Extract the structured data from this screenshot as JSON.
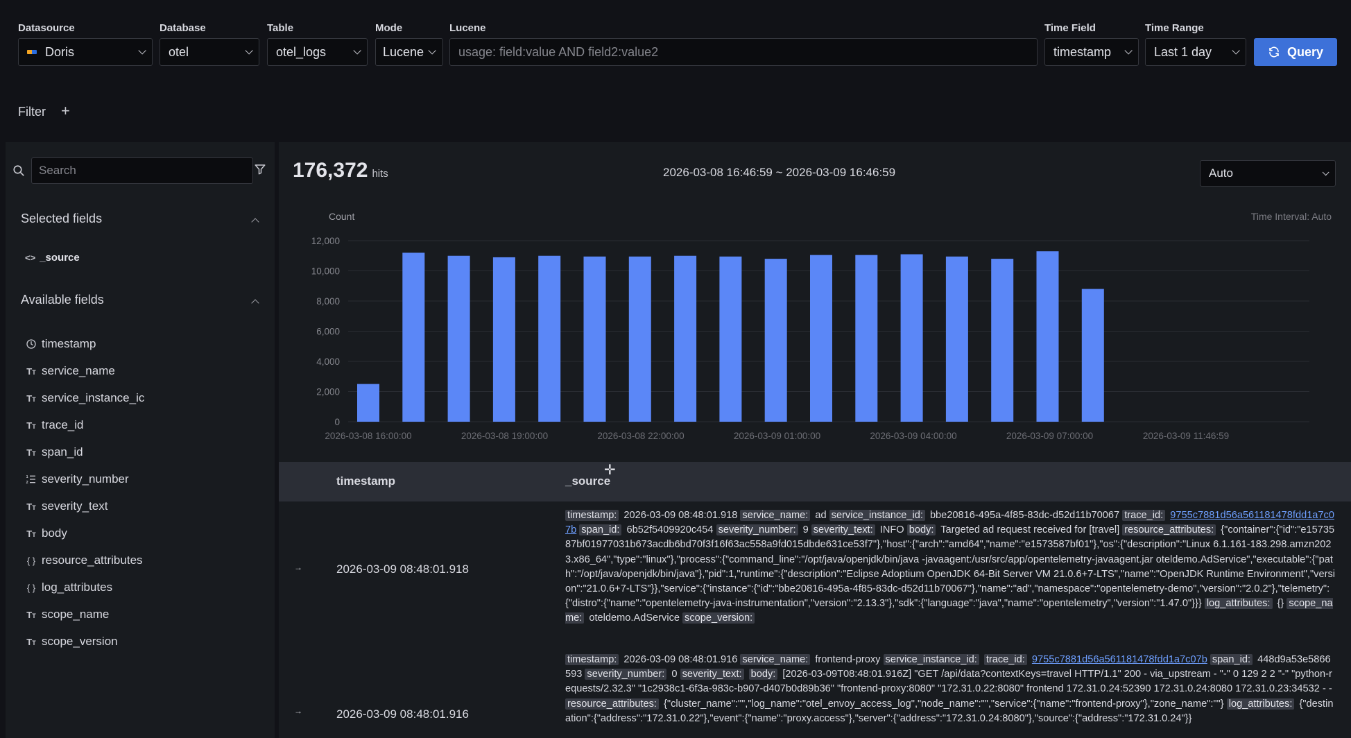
{
  "toolbar": {
    "datasource_label": "Datasource",
    "datasource_value": "Doris",
    "database_label": "Database",
    "database_value": "otel",
    "table_label": "Table",
    "table_value": "otel_logs",
    "mode_label": "Mode",
    "mode_value": "Lucene",
    "lucene_label": "Lucene",
    "lucene_placeholder": "usage: field:value AND field2:value2",
    "lucene_value": "",
    "timefield_label": "Time Field",
    "timefield_value": "timestamp",
    "timerange_label": "Time Range",
    "timerange_value": "Last 1 day",
    "query_label": "Query",
    "filter_label": "Filter",
    "filter_add": "+"
  },
  "sidebar": {
    "search_placeholder": "Search",
    "selected_title": "Selected fields",
    "selected_fields": [
      {
        "name": "_source",
        "icon": "code-icon"
      }
    ],
    "available_title": "Available fields",
    "available_fields": [
      {
        "name": "timestamp",
        "icon": "clock-icon"
      },
      {
        "name": "service_name",
        "icon": "text-type-icon"
      },
      {
        "name": "service_instance_ic",
        "icon": "text-type-icon"
      },
      {
        "name": "trace_id",
        "icon": "text-type-icon"
      },
      {
        "name": "span_id",
        "icon": "text-type-icon"
      },
      {
        "name": "severity_number",
        "icon": "number-type-icon"
      },
      {
        "name": "severity_text",
        "icon": "text-type-icon"
      },
      {
        "name": "body",
        "icon": "text-type-icon"
      },
      {
        "name": "resource_attributes",
        "icon": "object-type-icon"
      },
      {
        "name": "log_attributes",
        "icon": "object-type-icon"
      },
      {
        "name": "scope_name",
        "icon": "text-type-icon"
      },
      {
        "name": "scope_version",
        "icon": "text-type-icon"
      }
    ]
  },
  "summary": {
    "hits": "176,372",
    "hits_label": "hits",
    "range": "2026-03-08 16:46:59 ~ 2026-03-09 16:46:59",
    "interval_select": "Auto",
    "interval_note": "Time Interval: Auto"
  },
  "chart_data": {
    "type": "bar",
    "ylabel": "Count",
    "ylim": [
      0,
      12000
    ],
    "yticks": [
      "0",
      "2,000",
      "4,000",
      "6,000",
      "8,000",
      "10,000",
      "12,000"
    ],
    "xtick_labels": [
      "2026-03-08 16:00:00",
      "2026-03-08 19:00:00",
      "2026-03-08 22:00:00",
      "2026-03-09 01:00:00",
      "2026-03-09 04:00:00",
      "2026-03-09 07:00:00",
      "2026-03-09 11:46:59"
    ],
    "values": [
      2500,
      11200,
      11000,
      10900,
      11000,
      10950,
      10950,
      11000,
      10950,
      10800,
      11050,
      11050,
      11100,
      10950,
      10800,
      11300,
      8800
    ],
    "grid": true,
    "color": "#5b87f7"
  },
  "table": {
    "col_timestamp": "timestamp",
    "col_source": "_source",
    "rows": [
      {
        "timestamp": "2026-03-09 08:48:01.918",
        "parts": [
          {
            "k": "timestamp:",
            "v": " 2026-03-09 08:48:01.918 "
          },
          {
            "k": "service_name:",
            "v": " ad "
          },
          {
            "k": "service_instance_id:",
            "v": " bbe20816-495a-4f85-83dc-d52d11b70067 "
          },
          {
            "k": "trace_id:",
            "v": " ",
            "link": "9755c7881d56a561181478fdd1a7c07b"
          },
          {
            "k": "span_id:",
            "v": " 6b52f5409920c454 "
          },
          {
            "k": "severity_number:",
            "v": " 9 "
          },
          {
            "k": "severity_text:",
            "v": " INFO "
          },
          {
            "k": "body:",
            "v": " Targeted ad request received for [travel] "
          },
          {
            "k": "resource_attributes:",
            "v": " {\"container\":{\"id\":\"e1573587bf01977031b673acdb6bd70f3f16f63ac558a9fd015dbde631ce53f7\"},\"host\":{\"arch\":\"amd64\",\"name\":\"e1573587bf01\"},\"os\":{\"description\":\"Linux 6.1.161-183.298.amzn2023.x86_64\",\"type\":\"linux\"},\"process\":{\"command_line\":\"/opt/java/openjdk/bin/java -javaagent:/usr/src/app/opentelemetry-javaagent.jar oteldemo.AdService\",\"executable\":{\"path\":\"/opt/java/openjdk/bin/java\"},\"pid\":1,\"runtime\":{\"description\":\"Eclipse Adoptium OpenJDK 64-Bit Server VM 21.0.6+7-LTS\",\"name\":\"OpenJDK Runtime Environment\",\"version\":\"21.0.6+7-LTS\"}},\"service\":{\"instance\":{\"id\":\"bbe20816-495a-4f85-83dc-d52d11b70067\"},\"name\":\"ad\",\"namespace\":\"opentelemetry-demo\",\"version\":\"2.0.2\"},\"telemetry\":{\"distro\":{\"name\":\"opentelemetry-java-instrumentation\",\"version\":\"2.13.3\"},\"sdk\":{\"language\":\"java\",\"name\":\"opentelemetry\",\"version\":\"1.47.0\"}}} "
          },
          {
            "k": "log_attributes:",
            "v": " {} "
          },
          {
            "k": "scope_name:",
            "v": " oteldemo.AdService "
          },
          {
            "k": "scope_version:",
            "v": ""
          }
        ]
      },
      {
        "timestamp": "2026-03-09 08:48:01.916",
        "parts": [
          {
            "k": "timestamp:",
            "v": " 2026-03-09 08:48:01.916 "
          },
          {
            "k": "service_name:",
            "v": " frontend-proxy "
          },
          {
            "k": "service_instance_id:",
            "v": " "
          },
          {
            "k": "trace_id:",
            "v": " ",
            "link": "9755c7881d56a561181478fdd1a7c07b"
          },
          {
            "k": "span_id:",
            "v": " 448d9a53e5866593 "
          },
          {
            "k": "severity_number:",
            "v": " 0 "
          },
          {
            "k": "severity_text:",
            "v": " "
          },
          {
            "k": "body:",
            "v": " [2026-03-09T08:48:01.916Z] \"GET /api/data?contextKeys=travel HTTP/1.1\" 200 - via_upstream - \"-\" 0 129 2 2 \"-\" \"python-requests/2.32.3\" \"1c2938c1-6f3a-983c-b907-d407b0d89b36\" \"frontend-proxy:8080\" \"172.31.0.22:8080\" frontend 172.31.0.24:52390 172.31.0.24:8080 172.31.0.23:34532 - - "
          },
          {
            "k": "resource_attributes:",
            "v": " {\"cluster_name\":\"\",\"log_name\":\"otel_envoy_access_log\",\"node_name\":\"\",\"service\":{\"name\":\"frontend-proxy\"},\"zone_name\":\"\"} "
          },
          {
            "k": "log_attributes:",
            "v": " {\"destination\":{\"address\":\"172.31.0.22\"},\"event\":{\"name\":\"proxy.access\"},\"server\":{\"address\":\"172.31.0.24:8080\"},\"source\":{\"address\":\"172.31.0.24\"}} "
          }
        ]
      }
    ]
  }
}
